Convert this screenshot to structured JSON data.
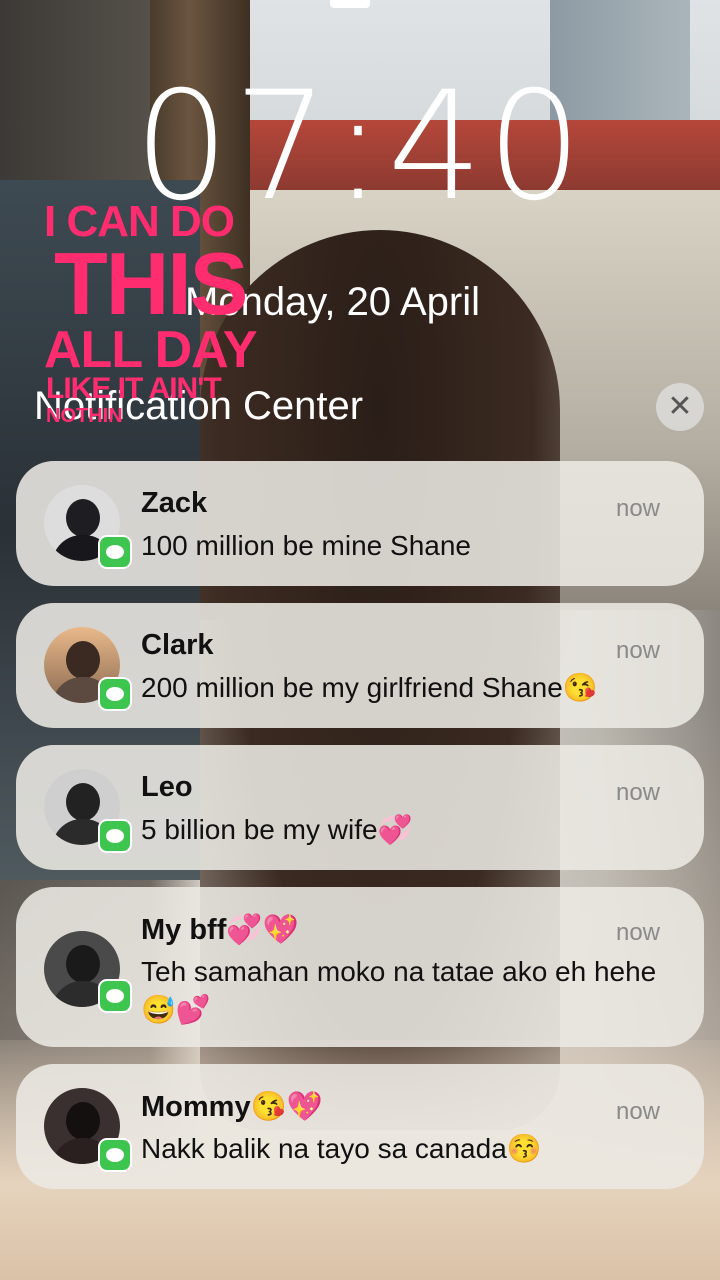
{
  "lockscreen": {
    "time": "07:40",
    "date": "Monday, 20 April",
    "notification_center_title": "Notification Center",
    "close_icon": "close-icon"
  },
  "sticker": {
    "line1": "I CAN DO",
    "line2": "THIS",
    "line3": "ALL DAY",
    "line4": "LIKE IT AIN'T",
    "line5": "NOTHIN",
    "color": "#ff2d6f"
  },
  "notifications": [
    {
      "sender": "Zack",
      "time": "now",
      "message": "100 million be mine Shane",
      "app_icon": "messages-icon"
    },
    {
      "sender": "Clark",
      "time": "now",
      "message": "200 million be my girlfriend Shane😘",
      "app_icon": "messages-icon"
    },
    {
      "sender": "Leo",
      "time": "now",
      "message": "5 billion be my wife💞",
      "app_icon": "messages-icon"
    },
    {
      "sender": "My bff💞💖",
      "time": "now",
      "message": "Teh samahan moko na tatae ako eh hehe😅💕",
      "app_icon": "messages-icon"
    },
    {
      "sender": "Mommy😘💖",
      "time": "now",
      "message": "Nakk balik na tayo sa canada😚",
      "app_icon": "messages-icon"
    }
  ],
  "colors": {
    "badge_green": "#3ec54f",
    "card_background": "#ece9e4"
  }
}
